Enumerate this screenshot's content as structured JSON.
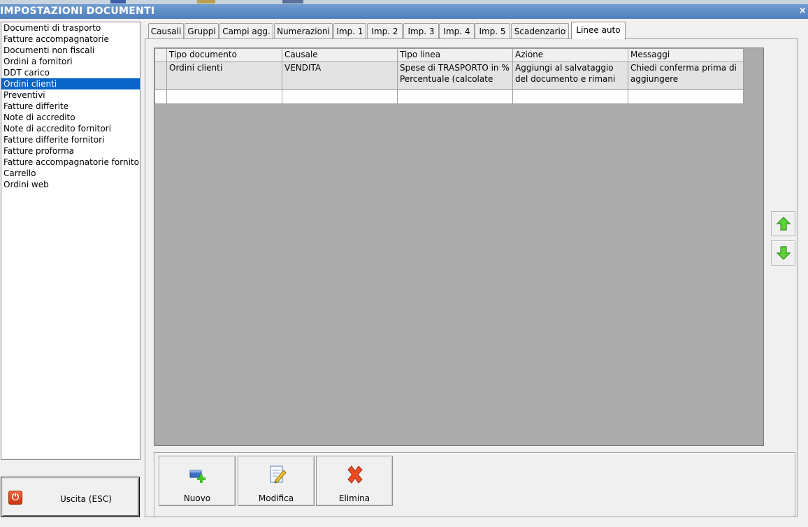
{
  "window": {
    "title": "IMPOSTAZIONI DOCUMENTI",
    "close_glyph": "×"
  },
  "doc_list": {
    "items": [
      "Documenti di trasporto",
      "Fatture accompagnatorie",
      "Documenti non fiscali",
      "Ordini a fornitori",
      "DDT carico",
      "Ordini clienti",
      "Preventivi",
      "Fatture differite",
      "Note di accredito",
      "Note di accredito fornitori",
      "Fatture differite fornitori",
      "Fatture proforma",
      "Fatture accompagnatorie fornitori",
      "Carrello",
      "Ordini web"
    ],
    "selected": "Ordini clienti"
  },
  "exit_button": {
    "label": "Uscita (ESC)",
    "icon": "power-icon"
  },
  "tabs": [
    "Causali",
    "Gruppi",
    "Campi agg.",
    "Numerazioni",
    "Imp. 1",
    "Imp. 2",
    "Imp. 3",
    "Imp. 4",
    "Imp. 5",
    "Scadenzario",
    "Linee auto"
  ],
  "active_tab": "Linee auto",
  "grid": {
    "columns": [
      "Tipo documento",
      "Causale",
      "Tipo linea",
      "Azione",
      "Messaggi"
    ],
    "rows": [
      [
        "Ordini clienti",
        "VENDITA",
        "Spese di TRASPORTO in % Percentuale (calcolate AU...",
        "Aggiungi al salvataggio del documento e rimani all'in...",
        "Chiedi conferma prima di aggiungere"
      ]
    ]
  },
  "side_buttons": {
    "up_icon": "arrow-up-icon",
    "down_icon": "arrow-down-icon"
  },
  "actions": {
    "new_label": "Nuovo",
    "edit_label": "Modifica",
    "delete_label": "Elimina"
  },
  "colors": {
    "titlebar": "#5b8ac5",
    "selection": "#0a64c8",
    "grid_background": "#ababab",
    "arrow_green": "#4cc22e",
    "delete_red": "#e84020"
  }
}
